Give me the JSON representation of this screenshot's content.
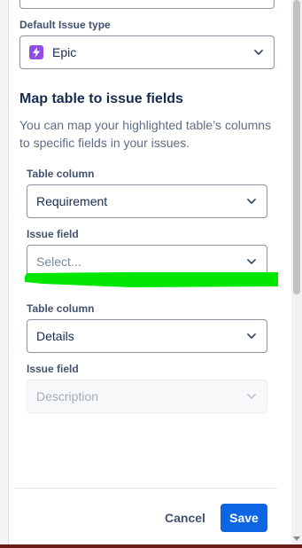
{
  "default_issue_type": {
    "label": "Default Issue type",
    "value": "Epic",
    "icon": "epic-icon",
    "icon_color": "#904ee2"
  },
  "mapping": {
    "title": "Map table to issue fields",
    "description": "You can map your highlighted table’s columns to specific fields in your issues.",
    "rows": [
      {
        "table_column_label": "Table column",
        "table_column_value": "Requirement",
        "issue_field_label": "Issue field",
        "issue_field_placeholder": "Select..."
      },
      {
        "table_column_label": "Table column",
        "table_column_value": "Details",
        "issue_field_label": "Issue field",
        "issue_field_value": "Description",
        "issue_field_disabled": true
      }
    ]
  },
  "footer": {
    "cancel_label": "Cancel",
    "save_label": "Save",
    "save_color": "#0c66e4"
  },
  "annotation": {
    "highlight_color": "#00e600"
  }
}
